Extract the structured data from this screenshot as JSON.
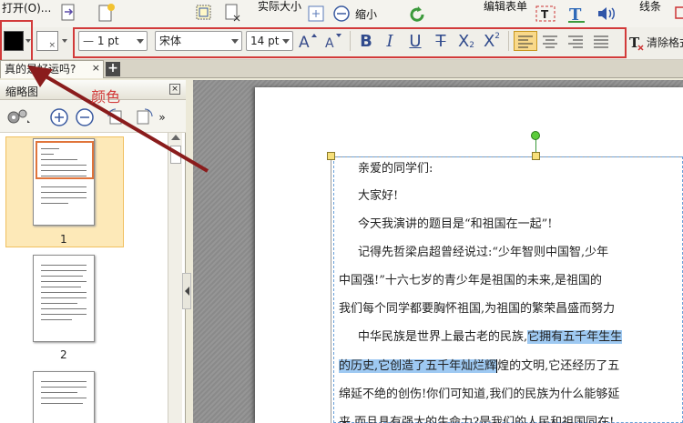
{
  "ribbon": {
    "open_label": "打开(O)...",
    "actual_size_label": "实际大小",
    "zoom_out_label": "缩小",
    "edit_form_label": "编辑表单",
    "line_label": "线条"
  },
  "format": {
    "fill_color": "#000000",
    "line_width": "1 pt",
    "font_name": "宋体",
    "font_size": "14 pt",
    "bold": "B",
    "italic": "I",
    "underline": "U",
    "strike": "T",
    "subscript": "X",
    "superscript": "X",
    "clear_format": "清除格式"
  },
  "tab": {
    "title": "真的是好运吗?",
    "close": "×"
  },
  "thumbs": {
    "header": "缩略图",
    "pages": [
      "1",
      "2"
    ]
  },
  "annotation": {
    "label": "颜色",
    "color": "#d23a3a"
  },
  "document": {
    "lines": [
      "亲爱的同学们:",
      "大家好!",
      "今天我演讲的题目是“和祖国在一起”!",
      "记得先哲梁启超曾经说过:“少年智则中国智,少年",
      "中国强!”十六七岁的青少年是祖国的未来,是祖国的",
      "我们每个同学都要胸怀祖国,为祖国的繁荣昌盛而努力",
      "中华民族是世界上最古老的民族,",
      "它拥有五千年生生",
      "的历史,它创造了五千年灿烂辉",
      "煌的文明,它还经历了五",
      "绵延不绝的创伤!你们可知道,我们的民族为什么能够延",
      "来,而且具有强大的生命力?是我们的人民和祖国同在!"
    ]
  },
  "colors": {
    "selection": "#9ec9f2",
    "accent_red": "#d23a3a"
  }
}
